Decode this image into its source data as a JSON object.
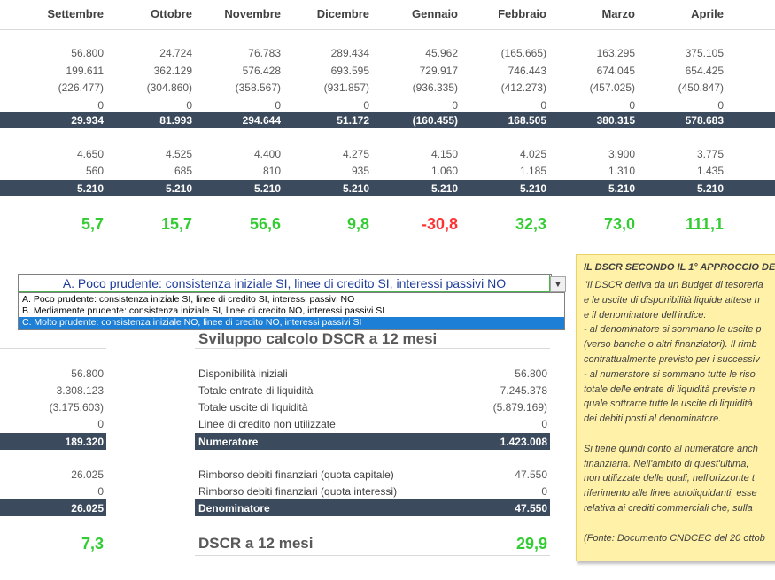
{
  "months": [
    "Settembre",
    "Ottobre",
    "Novembre",
    "Dicembre",
    "Gennaio",
    "Febbraio",
    "Marzo",
    "Aprile"
  ],
  "block1": {
    "rows": [
      [
        "56.800",
        "24.724",
        "76.783",
        "289.434",
        "45.962",
        "(165.665)",
        "163.295",
        "375.105"
      ],
      [
        "199.611",
        "362.129",
        "576.428",
        "693.595",
        "729.917",
        "746.443",
        "674.045",
        "654.425"
      ],
      [
        "(226.477)",
        "(304.860)",
        "(358.567)",
        "(931.857)",
        "(936.335)",
        "(412.273)",
        "(457.025)",
        "(450.847)"
      ],
      [
        "0",
        "0",
        "0",
        "0",
        "0",
        "0",
        "0",
        "0"
      ]
    ],
    "total": [
      "29.934",
      "81.993",
      "294.644",
      "51.172",
      "(160.455)",
      "168.505",
      "380.315",
      "578.683"
    ]
  },
  "block2": {
    "rows": [
      [
        "4.650",
        "4.525",
        "4.400",
        "4.275",
        "4.150",
        "4.025",
        "3.900",
        "3.775"
      ],
      [
        "560",
        "685",
        "810",
        "935",
        "1.060",
        "1.185",
        "1.310",
        "1.435"
      ]
    ],
    "total": [
      "5.210",
      "5.210",
      "5.210",
      "5.210",
      "5.210",
      "5.210",
      "5.210",
      "5.210"
    ]
  },
  "dscr_monthly": [
    "5,7",
    "15,7",
    "56,6",
    "9,8",
    "-30,8",
    "32,3",
    "73,0",
    "111,1"
  ],
  "dropdown": {
    "selected": "A.  Poco prudente: consistenza iniziale SI, linee di credito SI, interessi passivi NO",
    "options": [
      "A.  Poco prudente: consistenza iniziale SI, linee di credito SI, interessi passivi NO",
      "B.  Mediamente prudente: consistenza iniziale SI, linee di credito NO, interessi passivi SI",
      "C.  Molto prudente: consistenza iniziale NO, linee di credito NO, interessi passivi SI"
    ]
  },
  "section12": {
    "title": "Sviluppo calcolo DSCR a 12 mesi",
    "labels": [
      "Disponibilità iniziali",
      "Totale entrate di liquidità",
      "Totale uscite di liquidità",
      "Linee di credito non utilizzate"
    ],
    "values": [
      "56.800",
      "7.245.378",
      "(5.879.169)",
      "0"
    ],
    "left_values": [
      "56.800",
      "3.308.123",
      "(3.175.603)",
      "0"
    ],
    "numerator_label": "Numeratore",
    "numerator_value": "1.423.008",
    "numerator_left": "189.320",
    "debt_labels": [
      "Rimborso debiti finanziari (quota capitale)",
      "Rimborso debiti finanziari (quota interessi)"
    ],
    "debt_values": [
      "47.550",
      "0"
    ],
    "debt_left": [
      "26.025",
      "0"
    ],
    "denominator_label": "Denominatore",
    "denominator_value": "47.550",
    "denominator_left": "26.025",
    "dscr_label": "DSCR a 12 mesi",
    "dscr_value": "29,9",
    "dscr_left": "7,3"
  },
  "note": {
    "title": "IL DSCR SECONDO IL 1° APPROCCIO DEL",
    "lines": [
      "\"Il DSCR deriva da un Budget di tesoreria",
      "e le uscite di disponibilità liquide attese n",
      "e il denominatore dell'indice:",
      "- al denominatore si sommano le uscite p",
      "(verso banche o altri finanziatori). Il rimb",
      "contrattualmente previsto per i successiv",
      "- al numeratore si sommano tutte le riso",
      "totale delle entrate di liquidità previste n",
      "quale sottrarre tutte le uscite di liquidità",
      "dei debiti posti al denominatore.",
      "",
      "Si tiene quindi conto al numeratore anch",
      "finanziaria. Nell'ambito di quest'ultima,",
      "non utilizzate delle quali, nell'orizzonte t",
      "riferimento alle linee autoliquidanti, esse",
      "relativa ai crediti commerciali che, sulla",
      "",
      "(Fonte: Documento CNDCEC del 20 ottob"
    ]
  },
  "colors": {
    "header_bar": "#3b4a5c",
    "positive": "#33cc33",
    "negative": "#ff3333",
    "note_bg": "#fff2a8"
  }
}
